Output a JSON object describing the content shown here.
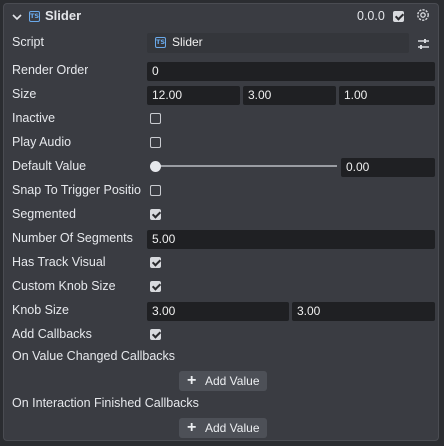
{
  "header": {
    "title": "Slider",
    "version": "0.0.0",
    "enabled": true,
    "icon": "ts-file-icon"
  },
  "script": {
    "label": "Script",
    "value": "Slider"
  },
  "render_order": {
    "label": "Render Order",
    "value": "0"
  },
  "size": {
    "label": "Size",
    "x": "12.00",
    "y": "3.00",
    "z": "1.00"
  },
  "inactive": {
    "label": "Inactive",
    "checked": false
  },
  "play_audio": {
    "label": "Play Audio",
    "checked": false
  },
  "default_value": {
    "label": "Default Value",
    "value": "0.00",
    "slider_fraction": 0
  },
  "snap_to_trigger": {
    "label": "Snap To Trigger Positio",
    "checked": false
  },
  "segmented": {
    "label": "Segmented",
    "checked": true
  },
  "number_of_segments": {
    "label": "Number Of Segments",
    "value": "5.00"
  },
  "has_track_visual": {
    "label": "Has Track Visual",
    "checked": true
  },
  "custom_knob_size": {
    "label": "Custom Knob Size",
    "checked": true
  },
  "knob_size": {
    "label": "Knob Size",
    "x": "3.00",
    "y": "3.00"
  },
  "add_callbacks": {
    "label": "Add Callbacks",
    "checked": true
  },
  "on_value_changed": {
    "label": "On Value Changed Callbacks",
    "button": "Add Value"
  },
  "on_interaction_finished": {
    "label": "On Interaction Finished Callbacks",
    "button": "Add Value"
  },
  "colors": {
    "panel": "#3a3c42",
    "field": "#1f2023",
    "accent": "#6aa9ea",
    "button": "#4d5057"
  }
}
